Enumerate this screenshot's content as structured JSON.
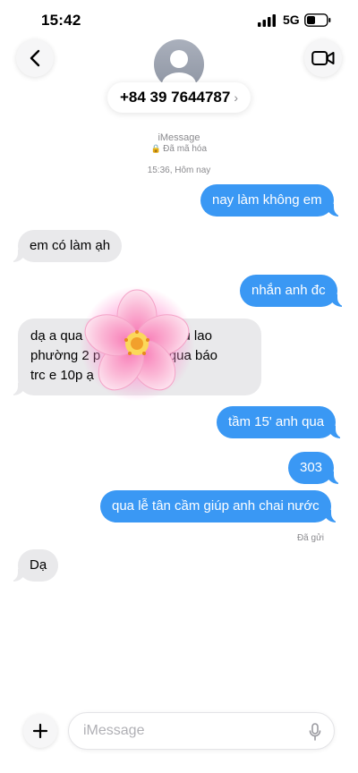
{
  "status": {
    "time": "15:42",
    "network": "5G"
  },
  "header": {
    "contact": "+84 39 7644787",
    "chevron": "›",
    "service": "iMessage",
    "encryption": "Đã mã hóa",
    "icons": [
      "chevron-left-icon",
      "avatar-person-icon",
      "video-camera-icon"
    ]
  },
  "thread": {
    "timestamp": "15:36, Hôm nay",
    "messages": [
      {
        "dir": "out",
        "text": "nay làm không em"
      },
      {
        "dir": "in",
        "text": "em có làm ạh"
      },
      {
        "dir": "out",
        "text": "nhắn anh đc"
      },
      {
        "dir": "in",
        "line1": "dạ a qua",
        "line1b": "ù lao",
        "line2": "phường 2 p",
        "line2b": "a qua báo",
        "line3": "trc e 10p ạ"
      },
      {
        "dir": "out",
        "text": "tầm 15' anh qua"
      },
      {
        "dir": "out",
        "text": "303"
      },
      {
        "dir": "out",
        "text": "qua lễ tân cầm giúp anh chai nước"
      },
      {
        "dir": "in",
        "text": "Dạ"
      }
    ],
    "read_receipt": "Đã gửi",
    "overlay": "cherry-blossom-emoji"
  },
  "composer": {
    "placeholder": "iMessage",
    "icons": [
      "plus-icon",
      "microphone-icon"
    ]
  },
  "colors": {
    "outgoing": "#3a98f4",
    "incoming": "#e9e9eb",
    "accent": "#3a98f4"
  }
}
